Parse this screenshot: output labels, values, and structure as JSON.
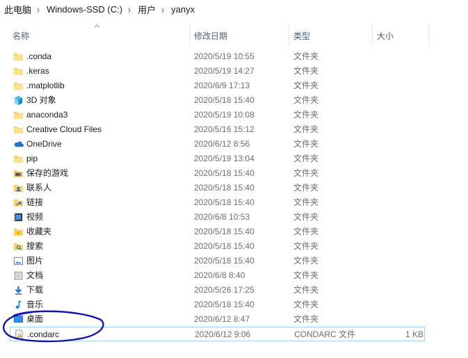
{
  "breadcrumb": [
    "此电脑",
    "Windows-SSD (C:)",
    "用户",
    "yanyx"
  ],
  "columns": {
    "name": "名称",
    "date": "修改日期",
    "type": "类型",
    "size": "大小"
  },
  "files": [
    {
      "name": ".conda",
      "date": "2020/5/19 10:55",
      "type": "文件夹",
      "size": "",
      "icon": "folder-icon"
    },
    {
      "name": ".keras",
      "date": "2020/5/19 14:27",
      "type": "文件夹",
      "size": "",
      "icon": "folder-icon"
    },
    {
      "name": ".matplotlib",
      "date": "2020/6/9 17:13",
      "type": "文件夹",
      "size": "",
      "icon": "folder-icon"
    },
    {
      "name": "3D 对象",
      "date": "2020/5/18 15:40",
      "type": "文件夹",
      "size": "",
      "icon": "3d-objects-icon"
    },
    {
      "name": "anaconda3",
      "date": "2020/5/19 10:08",
      "type": "文件夹",
      "size": "",
      "icon": "folder-icon"
    },
    {
      "name": "Creative Cloud Files",
      "date": "2020/5/16 15:12",
      "type": "文件夹",
      "size": "",
      "icon": "folder-icon"
    },
    {
      "name": "OneDrive",
      "date": "2020/6/12 8:56",
      "type": "文件夹",
      "size": "",
      "icon": "onedrive-icon"
    },
    {
      "name": "pip",
      "date": "2020/5/19 13:04",
      "type": "文件夹",
      "size": "",
      "icon": "folder-icon"
    },
    {
      "name": "保存的游戏",
      "date": "2020/5/18 15:40",
      "type": "文件夹",
      "size": "",
      "icon": "saved-games-icon"
    },
    {
      "name": "联系人",
      "date": "2020/5/18 15:40",
      "type": "文件夹",
      "size": "",
      "icon": "contacts-icon"
    },
    {
      "name": "链接",
      "date": "2020/5/18 15:40",
      "type": "文件夹",
      "size": "",
      "icon": "links-icon"
    },
    {
      "name": "视频",
      "date": "2020/6/8 10:53",
      "type": "文件夹",
      "size": "",
      "icon": "videos-icon"
    },
    {
      "name": "收藏夹",
      "date": "2020/5/18 15:40",
      "type": "文件夹",
      "size": "",
      "icon": "favorites-icon"
    },
    {
      "name": "搜索",
      "date": "2020/5/18 15:40",
      "type": "文件夹",
      "size": "",
      "icon": "searches-icon"
    },
    {
      "name": "图片",
      "date": "2020/5/18 15:40",
      "type": "文件夹",
      "size": "",
      "icon": "pictures-icon"
    },
    {
      "name": "文档",
      "date": "2020/6/8 8:40",
      "type": "文件夹",
      "size": "",
      "icon": "documents-icon"
    },
    {
      "name": "下载",
      "date": "2020/5/26 17:25",
      "type": "文件夹",
      "size": "",
      "icon": "downloads-icon"
    },
    {
      "name": "音乐",
      "date": "2020/5/18 15:40",
      "type": "文件夹",
      "size": "",
      "icon": "music-icon"
    },
    {
      "name": "桌面",
      "date": "2020/6/12 8:47",
      "type": "文件夹",
      "size": "",
      "icon": "desktop-icon"
    },
    {
      "name": ".condarc",
      "date": "2020/6/12 9:06",
      "type": "CONDARC 文件",
      "size": "1 KB",
      "icon": "file-icon",
      "selected": true
    }
  ],
  "colors": {
    "annotation": "#1414a8",
    "selection_border": "#99d1ff",
    "folder": "#f8d16a"
  }
}
